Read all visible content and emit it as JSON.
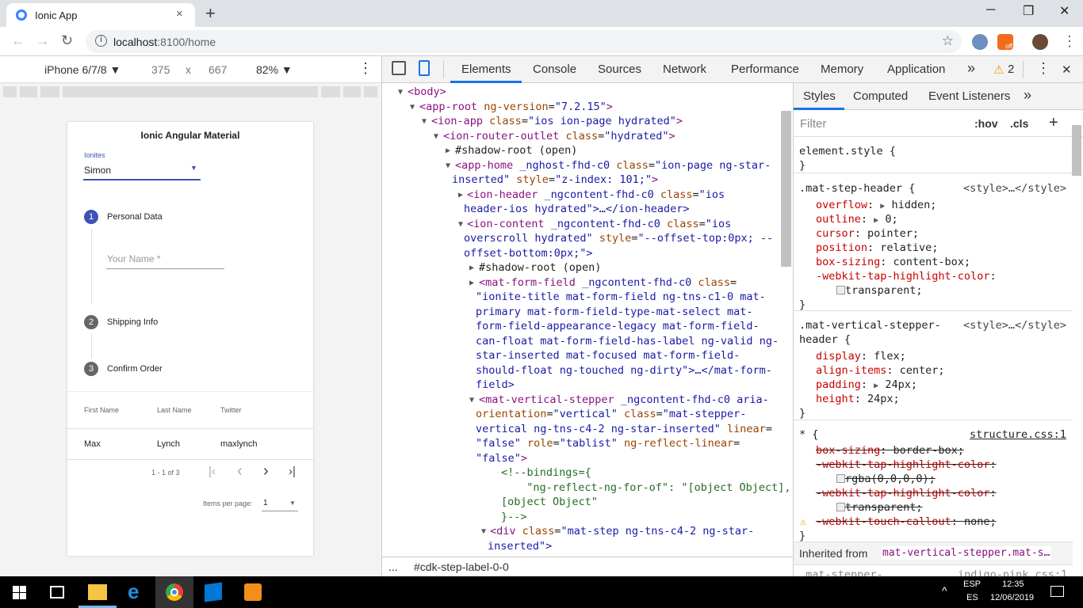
{
  "browser": {
    "tab_title": "Ionic App",
    "tab_close": "×",
    "new_tab": "+",
    "url_host": "localhost",
    "url_rest": ":8100/home",
    "minimize": "─",
    "maximize": "❐",
    "close": "✕",
    "back": "←",
    "forward": "→",
    "reload": "↻",
    "info": "i",
    "star": "☆",
    "ext_badge": "off"
  },
  "device_toolbar": {
    "device": "iPhone 6/7/8 ▼",
    "width": "375",
    "times": "x",
    "height": "667",
    "zoom": "82% ▼",
    "menu": "⋮"
  },
  "app": {
    "header": "Ionic Angular Material",
    "select_label": "Ionites",
    "select_value": "Simon",
    "steps": [
      {
        "num": "1",
        "label": "Personal Data"
      },
      {
        "num": "2",
        "label": "Shipping Info"
      },
      {
        "num": "3",
        "label": "Confirm Order"
      }
    ],
    "name_placeholder": "Your Name *",
    "table": {
      "headers": [
        "First Name",
        "Last Name",
        "Twitter"
      ],
      "row": [
        "Max",
        "Lynch",
        "maxlynch"
      ]
    },
    "paginator": {
      "range": "1 - 1 of 3",
      "items_label": "Items per page:",
      "items_value": "1",
      "first": "|‹",
      "prev": "‹",
      "next": "›",
      "last": "›|"
    }
  },
  "devtools": {
    "tabs": [
      "Elements",
      "Console",
      "Sources",
      "Network",
      "Performance",
      "Memory",
      "Application"
    ],
    "more": "»",
    "warnings": "2",
    "warn_icon": "⚠",
    "menu": "⋮",
    "close": "✕",
    "breadcrumb": "#cdk-step-label-0-0",
    "crumb_dots": "...",
    "style_tabs": [
      "Styles",
      "Computed",
      "Event Listeners"
    ],
    "filter_placeholder": "Filter",
    "hov": ":hov",
    "cls": ".cls",
    "plus": "+",
    "inherited_from_label": "Inherited from",
    "inherited_from_value": "mat-vertical-stepper.mat-s…",
    "bottom_line": ".mat-stepper-…",
    "bottom_src": "indigo-pink.css:1"
  },
  "dom_lines": [
    "<body>",
    "<app-root ng-version=\"7.2.15\">",
    "<ion-app class=\"ios ion-page hydrated\">",
    "<ion-router-outlet class=\"hydrated\">",
    "#shadow-root (open)",
    "<app-home _nghost-fhd-c0 class=\"ion-page ng-star-",
    "inserted\" style=\"z-index: 101;\">",
    "<ion-header _ngcontent-fhd-c0 class=\"ios",
    "header-ios hydrated\">…</ion-header>",
    "<ion-content _ngcontent-fhd-c0 class=\"ios",
    "overscroll hydrated\" style=\"--offset-top:0px; --",
    "offset-bottom:0px;\">",
    "#shadow-root (open)",
    "<mat-form-field _ngcontent-fhd-c0 class=",
    "\"ionite-title mat-form-field ng-tns-c1-0 mat-",
    "primary mat-form-field-type-mat-select mat-",
    "form-field-appearance-legacy mat-form-field-",
    "can-float mat-form-field-has-label ng-valid ng-",
    "star-inserted mat-focused mat-form-field-",
    "should-float ng-touched ng-dirty\">…</mat-form-",
    "field>",
    "<mat-vertical-stepper _ngcontent-fhd-c0 aria-",
    "orientation=\"vertical\" class=\"mat-stepper-",
    "vertical ng-tns-c4-2 ng-star-inserted\" linear=",
    "\"false\" role=\"tablist\" ng-reflect-linear=",
    "\"false\">",
    "<!--bindings={",
    "  \"ng-reflect-ng-for-of\": \"[object Object],",
    "[object Object\"",
    "}-->",
    "<div class=\"mat-step ng-tns-c4-2 ng-star-",
    "inserted\">"
  ],
  "style_lines": [
    "element.style {",
    "}",
    ".mat-step-header {",
    "<style>…</style>",
    "overflow",
    "hidden;",
    "outline",
    "0;",
    "cursor",
    "pointer;",
    "position",
    "relative;",
    "box-sizing",
    "content-box;",
    "-webkit-tap-highlight-color",
    "transparent;",
    "}",
    ".mat-vertical-stepper-",
    "header {",
    "<style>…</style>",
    "display",
    "flex;",
    "align-items",
    "center;",
    "padding",
    "24px;",
    "height",
    "24px;",
    "}",
    "* {",
    "structure.css:1",
    "box-sizing",
    "border-box;",
    "-webkit-tap-highlight-color",
    "rgba(0,0,0,0);",
    "-webkit-tap-highlight-color",
    "transparent;",
    "-webkit-touch-callout",
    "none;",
    "}"
  ],
  "taskbar": {
    "lang1": "ESP",
    "lang2": "ES",
    "time": "12:35",
    "date": "12/06/2019",
    "caret": "^"
  },
  "colors": {
    "accent": "#3f51b5",
    "devtools_tab_active": "#1a73e8",
    "tag": "#881280",
    "attr_name": "#994500",
    "attr_value": "#1a1aa6",
    "css_prop": "#c80000"
  }
}
